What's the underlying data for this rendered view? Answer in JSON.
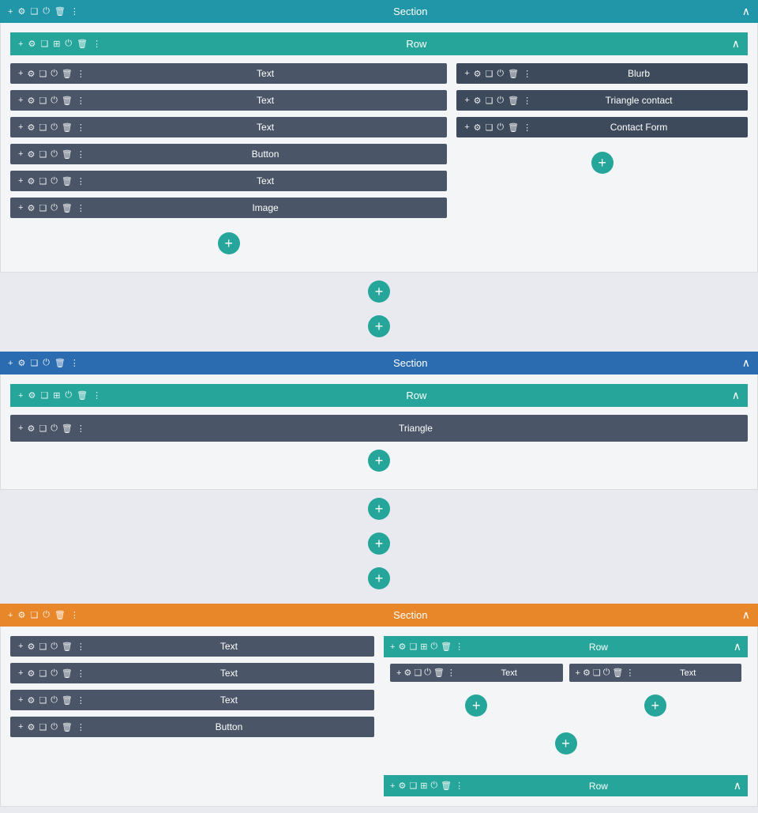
{
  "sections": [
    {
      "id": "section1",
      "barColor": "teal",
      "label": "Section",
      "rows": [
        {
          "label": "Row",
          "leftWidgets": [
            {
              "label": "Text"
            },
            {
              "label": "Text"
            },
            {
              "label": "Text"
            },
            {
              "label": "Button"
            },
            {
              "label": "Text"
            },
            {
              "label": "Image"
            }
          ],
          "rightWidgets": [
            {
              "label": "Blurb"
            },
            {
              "label": "Triangle contact"
            },
            {
              "label": "Contact Form"
            }
          ]
        }
      ]
    },
    {
      "id": "section2",
      "barColor": "blue",
      "label": "Section",
      "rows": [
        {
          "label": "Row",
          "singleWidget": {
            "label": "Triangle"
          }
        }
      ]
    },
    {
      "id": "section3",
      "barColor": "orange",
      "label": "Section",
      "leftWidgets": [
        {
          "label": "Text"
        },
        {
          "label": "Text"
        },
        {
          "label": "Text"
        },
        {
          "label": "Button"
        }
      ],
      "rightRows": [
        {
          "label": "Row",
          "widgets": [
            {
              "label": "Text"
            },
            {
              "label": "Text"
            }
          ]
        },
        {
          "label": "Row"
        }
      ]
    }
  ],
  "icons": {
    "plus": "+",
    "gear": "⚙",
    "copy": "❏",
    "power": "⏻",
    "trash": "🗑",
    "more": "⋮",
    "chevronUp": "∧",
    "chevronDown": "∨"
  },
  "addButtonLabel": "+",
  "colors": {
    "tealBar": "#2196a8",
    "blueBar": "#2b6cb0",
    "orangeBar": "#e8872a",
    "rowBar": "#26a69a",
    "widgetBar": "#4a5568",
    "addBtn": "#26a69a"
  }
}
